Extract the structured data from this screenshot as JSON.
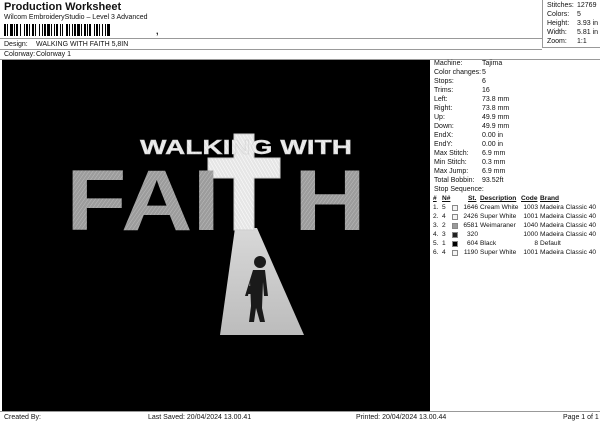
{
  "header": {
    "title": "Production Worksheet",
    "software": "Wilcom EmbroideryStudio – Level 3 Advanced",
    "barcode_suffix": ","
  },
  "stats": [
    {
      "label": "Stitches:",
      "value": "12769"
    },
    {
      "label": "Colors:",
      "value": "5"
    },
    {
      "label": "Height:",
      "value": "3.93 in"
    },
    {
      "label": "Width:",
      "value": "5.81 in"
    },
    {
      "label": "Zoom:",
      "value": "1:1"
    }
  ],
  "info": [
    {
      "label": "Design:",
      "value": "WALKING WITH FAITH 5,8IN"
    },
    {
      "label": "Colorway:",
      "value": "Colorway 1"
    }
  ],
  "design": {
    "line1": "WALKING WITH",
    "line2": "FAI",
    "line3": "H"
  },
  "properties": [
    {
      "label": "Machine:",
      "value": "Tajima"
    },
    {
      "label": "Color changes:",
      "value": "5"
    },
    {
      "label": "Stops:",
      "value": "6"
    },
    {
      "label": "Trims:",
      "value": "16"
    },
    {
      "label": "Left:",
      "value": "73.8 mm"
    },
    {
      "label": "Right:",
      "value": "73.8 mm"
    },
    {
      "label": "Up:",
      "value": "49.9 mm"
    },
    {
      "label": "Down:",
      "value": "49.9 mm"
    },
    {
      "label": "EndX:",
      "value": "0.00 in"
    },
    {
      "label": "EndY:",
      "value": "0.00 in"
    },
    {
      "label": "Max Stitch:",
      "value": "6.9 mm"
    },
    {
      "label": "Min Stitch:",
      "value": "0.3 mm"
    },
    {
      "label": "Max Jump:",
      "value": "6.9 mm"
    },
    {
      "label": "Total Bobbin:",
      "value": "93.52ft"
    }
  ],
  "stop_sequence": {
    "title": "Stop Sequence:",
    "headers": {
      "num": "#",
      "n": "N#",
      "st": "St.",
      "desc": "Description",
      "code": "Code",
      "brand": "Brand"
    },
    "rows": [
      {
        "num": "1.",
        "n": "5",
        "color": "#f4f4f4",
        "st": "1646",
        "desc": "Cream White",
        "code": "1003",
        "brand": "Madeira Classic 40"
      },
      {
        "num": "2.",
        "n": "4",
        "color": "#f4f4f4",
        "st": "2426",
        "desc": "Super White",
        "code": "1001",
        "brand": "Madeira Classic 40"
      },
      {
        "num": "3.",
        "n": "2",
        "color": "#9a9a9a",
        "st": "6581",
        "desc": "Weimaraner",
        "code": "1040",
        "brand": "Madeira Classic 40"
      },
      {
        "num": "4.",
        "n": "3",
        "color": "#222222",
        "st": "320",
        "desc": "",
        "code": "1000",
        "brand": "Madeira Classic 40"
      },
      {
        "num": "5.",
        "n": "1",
        "color": "#000000",
        "st": "604",
        "desc": "Black",
        "code": "8",
        "brand": "Default"
      },
      {
        "num": "6.",
        "n": "4",
        "color": "#f4f4f4",
        "st": "1190",
        "desc": "Super White",
        "code": "1001",
        "brand": "Madeira Classic 40"
      }
    ]
  },
  "footer": {
    "created_by": "Created By:",
    "last_saved": "Last Saved: 20/04/2024 13.00.41",
    "printed": "Printed: 20/04/2024 13.00.44",
    "page": "Page 1 of 1"
  }
}
